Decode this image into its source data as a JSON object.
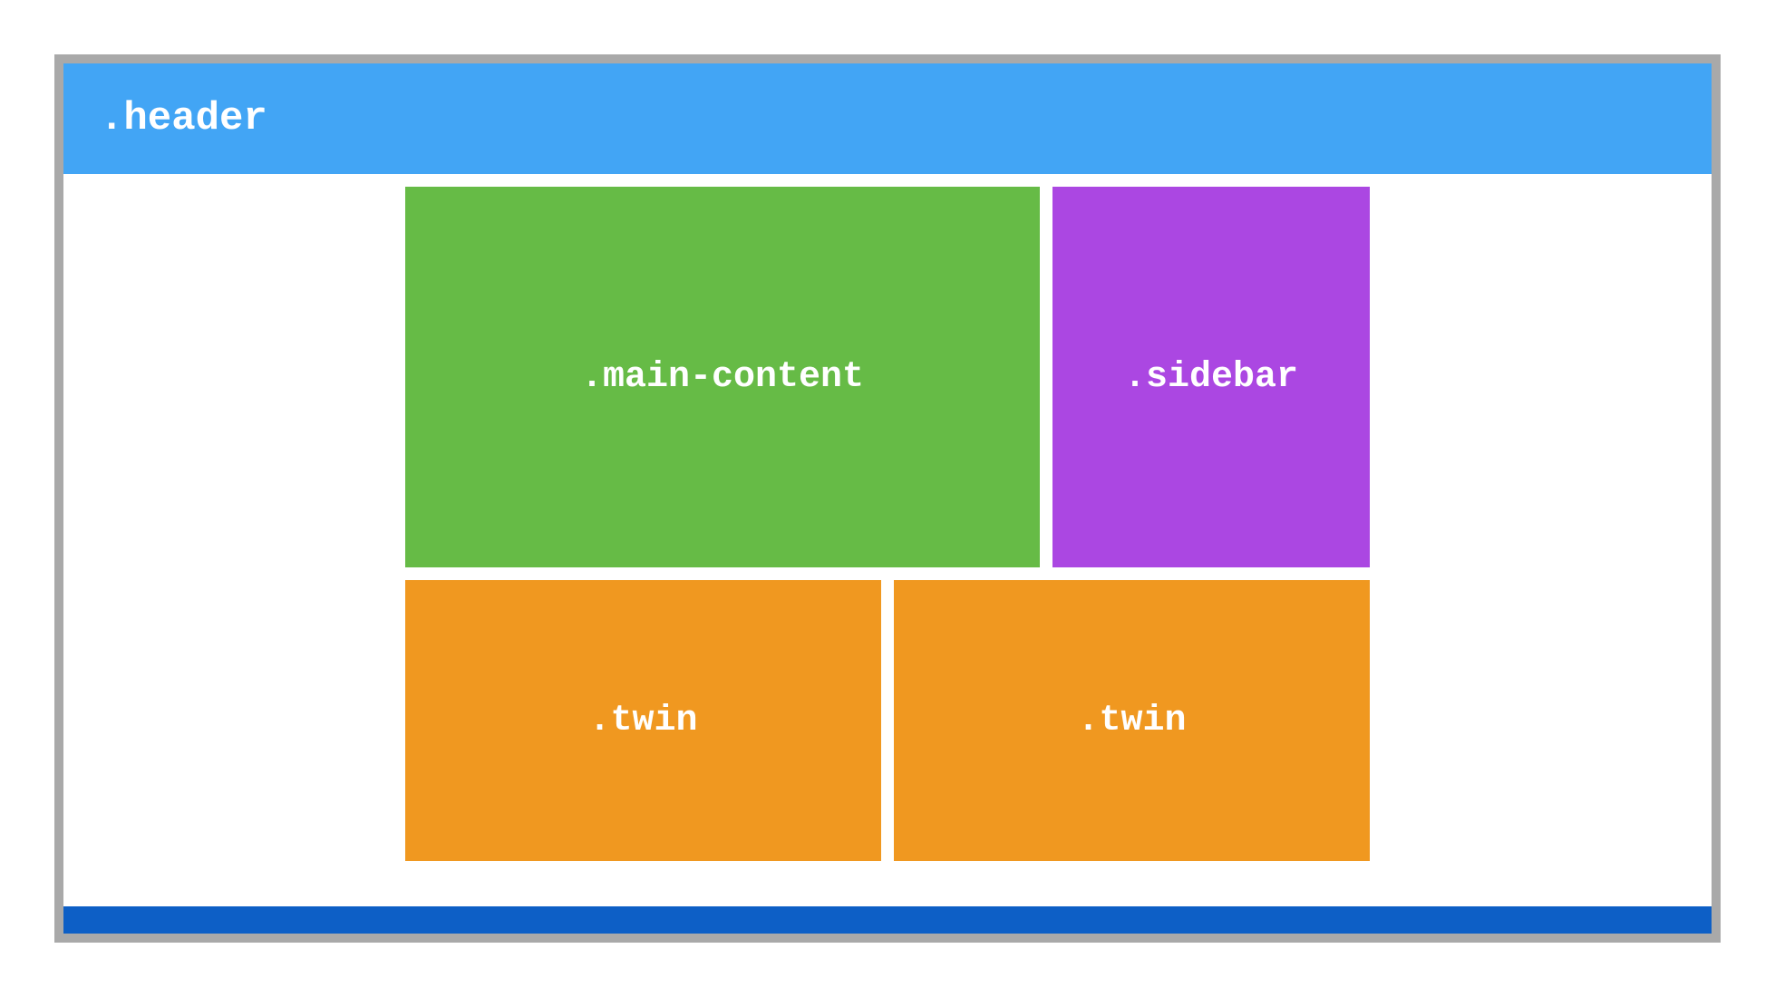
{
  "layout": {
    "header_label": ".header",
    "main_content_label": ".main-content",
    "sidebar_label": ".sidebar",
    "twin_label_1": ".twin",
    "twin_label_2": ".twin"
  },
  "colors": {
    "frame_border": "#a9a9a9",
    "header_bg": "#42a5f5",
    "main_content_bg": "#66bb46",
    "sidebar_bg": "#ab47e2",
    "twin_bg": "#f09820",
    "footer_bg": "#0d5fc6",
    "text": "#ffffff"
  }
}
